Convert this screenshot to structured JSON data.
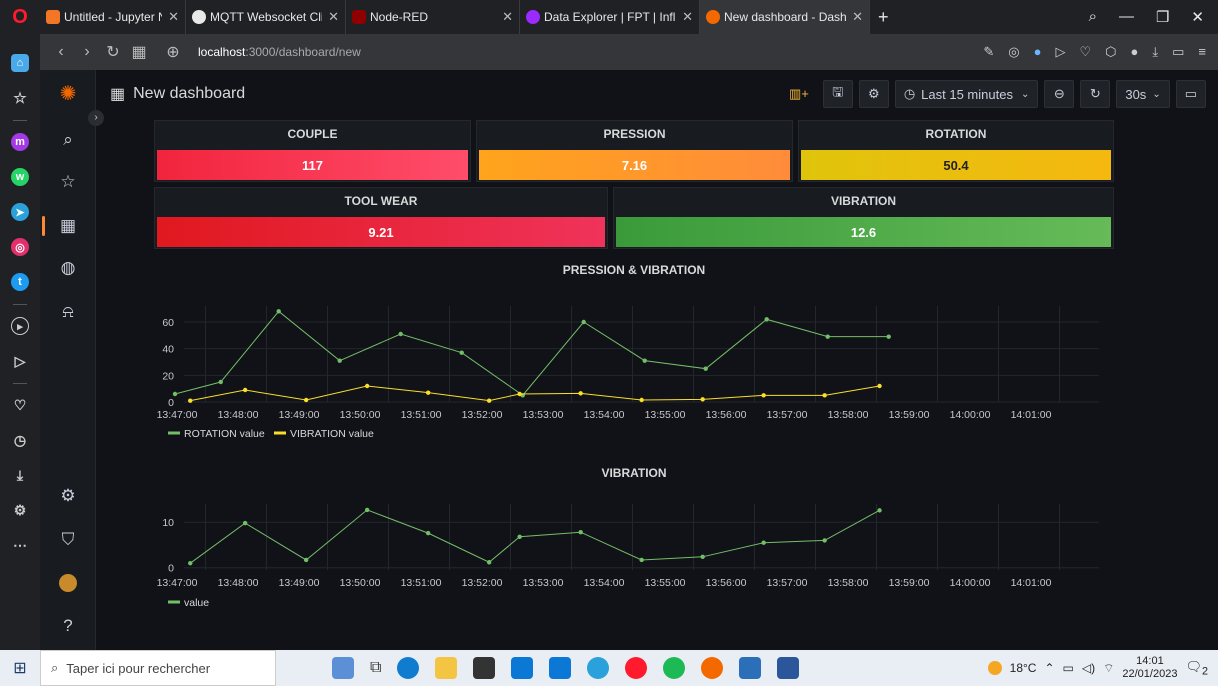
{
  "browser": {
    "tabs": [
      {
        "label": "Untitled - Jupyter Noteboo",
        "icon": "jupyter-icon",
        "color": "#f37626"
      },
      {
        "label": "MQTT Websocket Client",
        "icon": "globe-icon",
        "color": "#e8e8e8"
      },
      {
        "label": "Node-RED",
        "icon": "node-red-icon",
        "color": "#8f0000"
      },
      {
        "label": "Data Explorer | FPT | Influx",
        "icon": "influx-icon",
        "color": "#9b2aff"
      },
      {
        "label": "New dashboard - Dashboa",
        "icon": "grafana-icon",
        "color": "#f46800"
      }
    ],
    "new_tab": "+",
    "url_host": "localhost",
    "url_path": ":3000/dashboard/new"
  },
  "grafana": {
    "dashboard_title": "New dashboard",
    "time_range": "Last 15 minutes",
    "refresh": "30s",
    "stats": [
      {
        "title": "COUPLE",
        "value": "117",
        "gradient": [
          "#f2243d",
          "#ff4d6a"
        ]
      },
      {
        "title": "PRESSION",
        "value": "7.16",
        "gradient": [
          "#ffa41b",
          "#ff8c3a"
        ]
      },
      {
        "title": "ROTATION",
        "value": "50.4",
        "gradient": [
          "#e0c40c",
          "#f5b80f"
        ]
      },
      {
        "title": "TOOL WEAR",
        "value": "9.21",
        "gradient": [
          "#e0181f",
          "#f0335a"
        ]
      },
      {
        "title": "VIBRATION",
        "value": "12.6",
        "gradient": [
          "#3a9a3a",
          "#66bb58"
        ]
      }
    ]
  },
  "chart_data": [
    {
      "type": "line",
      "title": "PRESSION & VIBRATION",
      "x": [
        "13:47:00",
        "13:48:00",
        "13:49:00",
        "13:50:00",
        "13:51:00",
        "13:52:00",
        "13:53:00",
        "13:54:00",
        "13:55:00",
        "13:56:00",
        "13:57:00",
        "13:58:00",
        "13:59:00",
        "14:00:00",
        "14:01:00"
      ],
      "yticks": [
        0,
        20,
        40,
        60
      ],
      "ylim": [
        0,
        72
      ],
      "series": [
        {
          "name": "ROTATION value",
          "color": "#73bf69",
          "points": [
            [
              -0.35,
              6
            ],
            [
              0.4,
              15
            ],
            [
              1.35,
              68
            ],
            [
              2.35,
              31
            ],
            [
              3.35,
              51
            ],
            [
              4.35,
              37
            ],
            [
              5.35,
              5
            ],
            [
              6.35,
              60
            ],
            [
              7.35,
              31
            ],
            [
              8.35,
              25
            ],
            [
              9.35,
              62
            ],
            [
              10.35,
              49
            ],
            [
              11.35,
              49
            ]
          ]
        },
        {
          "name": "VIBRATION value",
          "color": "#fade2a",
          "points": [
            [
              -0.1,
              1
            ],
            [
              0.8,
              9
            ],
            [
              1.8,
              1.5
            ],
            [
              2.8,
              12
            ],
            [
              3.8,
              7
            ],
            [
              4.8,
              1
            ],
            [
              5.3,
              6
            ],
            [
              6.3,
              6.5
            ],
            [
              7.3,
              1.5
            ],
            [
              8.3,
              2
            ],
            [
              9.3,
              5
            ],
            [
              10.3,
              5
            ],
            [
              11.2,
              12
            ]
          ]
        }
      ],
      "legend": "bottom-left",
      "grid": true
    },
    {
      "type": "line",
      "title": "VIBRATION",
      "x": [
        "13:47:00",
        "13:48:00",
        "13:49:00",
        "13:50:00",
        "13:51:00",
        "13:52:00",
        "13:53:00",
        "13:54:00",
        "13:55:00",
        "13:56:00",
        "13:57:00",
        "13:58:00",
        "13:59:00",
        "14:00:00",
        "14:01:00"
      ],
      "yticks": [
        0,
        10
      ],
      "ylim": [
        -0.5,
        14
      ],
      "series": [
        {
          "name": "value",
          "color": "#73bf69",
          "points": [
            [
              -0.1,
              1
            ],
            [
              0.8,
              9.8
            ],
            [
              1.8,
              1.7
            ],
            [
              2.8,
              12.7
            ],
            [
              3.8,
              7.6
            ],
            [
              4.8,
              1.2
            ],
            [
              5.3,
              6.8
            ],
            [
              6.3,
              7.8
            ],
            [
              7.3,
              1.7
            ],
            [
              8.3,
              2.4
            ],
            [
              9.3,
              5.5
            ],
            [
              10.3,
              6
            ],
            [
              11.2,
              12.6
            ]
          ]
        }
      ],
      "legend": "bottom-left",
      "grid": true
    }
  ],
  "taskbar": {
    "search_placeholder": "Taper ici pour rechercher",
    "weather": "18°C",
    "time": "14:01",
    "date": "22/01/2023",
    "notifications": "2"
  }
}
